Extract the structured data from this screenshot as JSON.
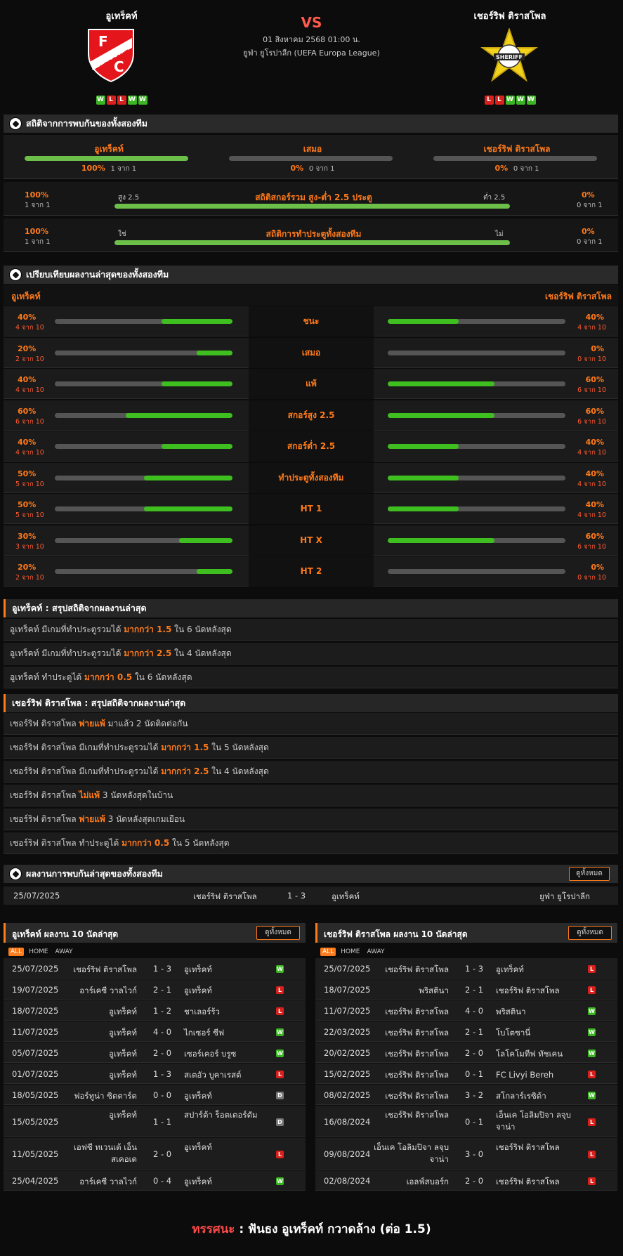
{
  "match": {
    "home": "อูเทร็คท์",
    "away": "เชอร์ริฟ ติราสโพล",
    "vs": "VS",
    "datetime": "01 สิงหาคม 2568 01:00 น.",
    "competition": "ยูฟ่า ยูโรปาลีก (UEFA Europa League)",
    "home_form": [
      "W",
      "L",
      "L",
      "W",
      "W"
    ],
    "away_form": [
      "L",
      "L",
      "W",
      "W",
      "W"
    ]
  },
  "h2h": {
    "title": "สถิติจากการพบกันของทั้งสองทีม",
    "home_label": "อูเทร็คท์",
    "draw_label": "เสมอ",
    "away_label": "เชอร์ริฟ ติราสโพล",
    "home_pct": "100%",
    "home_of": "1 จาก 1",
    "draw_pct": "0%",
    "draw_of": "0 จาก 1",
    "away_pct": "0%",
    "away_of": "0 จาก 1",
    "home_frac": 1.0,
    "draw_frac": 0,
    "away_frac": 0
  },
  "ou": {
    "title": "สถิติสกอร์รวม สูง-ต่ำ 2.5 ประตู",
    "left_label": "สูง 2.5",
    "right_label": "ต่ำ 2.5",
    "left_pct": "100%",
    "left_of": "1 จาก 1",
    "right_pct": "0%",
    "right_of": "0 จาก 1",
    "frac": 1.0
  },
  "btts": {
    "title": "สถิติการทำประตูทั้งสองทีม",
    "left_label": "ใช่",
    "right_label": "ไม่",
    "left_pct": "100%",
    "left_of": "1 จาก 1",
    "right_pct": "0%",
    "right_of": "0 จาก 1",
    "frac": 1.0
  },
  "compare": {
    "title": "เปรียบเทียบผลงานล่าสุดของทั้งสองทีม",
    "home": "อูเทร็คท์",
    "away": "เชอร์ริฟ ติราสโพล",
    "rows": [
      {
        "label": "ชนะ",
        "h_pct": "40%",
        "h_of": "4 จาก 10",
        "h": 0.4,
        "a_pct": "40%",
        "a_of": "4 จาก 10",
        "a": 0.4
      },
      {
        "label": "เสมอ",
        "h_pct": "20%",
        "h_of": "2 จาก 10",
        "h": 0.2,
        "a_pct": "0%",
        "a_of": "0 จาก 10",
        "a": 0
      },
      {
        "label": "แพ้",
        "h_pct": "40%",
        "h_of": "4 จาก 10",
        "h": 0.4,
        "a_pct": "60%",
        "a_of": "6 จาก 10",
        "a": 0.6
      },
      {
        "label": "สกอร์สูง 2.5",
        "h_pct": "60%",
        "h_of": "6 จาก 10",
        "h": 0.6,
        "a_pct": "60%",
        "a_of": "6 จาก 10",
        "a": 0.6
      },
      {
        "label": "สกอร์ต่ำ 2.5",
        "h_pct": "40%",
        "h_of": "4 จาก 10",
        "h": 0.4,
        "a_pct": "40%",
        "a_of": "4 จาก 10",
        "a": 0.4
      },
      {
        "label": "ทำประตูทั้งสองทีม",
        "h_pct": "50%",
        "h_of": "5 จาก 10",
        "h": 0.5,
        "a_pct": "40%",
        "a_of": "4 จาก 10",
        "a": 0.4
      },
      {
        "label": "HT 1",
        "h_pct": "50%",
        "h_of": "5 จาก 10",
        "h": 0.5,
        "a_pct": "40%",
        "a_of": "4 จาก 10",
        "a": 0.4
      },
      {
        "label": "HT X",
        "h_pct": "30%",
        "h_of": "3 จาก 10",
        "h": 0.3,
        "a_pct": "60%",
        "a_of": "6 จาก 10",
        "a": 0.6
      },
      {
        "label": "HT 2",
        "h_pct": "20%",
        "h_of": "2 จาก 10",
        "h": 0.2,
        "a_pct": "0%",
        "a_of": "0 จาก 10",
        "a": 0
      }
    ]
  },
  "home_summary": {
    "title": "อูเทร็คท์ : สรุปสถิติจากผลงานล่าสุด",
    "rows": [
      [
        "อูเทร็คท์  มีเกมที่ทำประตูรวมได้ ",
        "มากกว่า  1.5",
        " ใน 6 นัดหลังสุด"
      ],
      [
        "อูเทร็คท์  มีเกมที่ทำประตูรวมได้ ",
        "มากกว่า  2.5",
        " ใน 4 นัดหลังสุด"
      ],
      [
        "อูเทร็คท์  ทำประตูได้ ",
        "มากกว่า  0.5",
        " ใน 6 นัดหลังสุด"
      ]
    ]
  },
  "away_summary": {
    "title": "เชอร์ริฟ ติราสโพล : สรุปสถิติจากผลงานล่าสุด",
    "rows": [
      [
        "เชอร์ริฟ ติราสโพล ",
        "พ่ายแพ้",
        " มาแล้ว 2 นัดติดต่อกัน"
      ],
      [
        "เชอร์ริฟ ติราสโพล  มีเกมที่ทำประตูรวมได้ ",
        "มากกว่า  1.5",
        " ใน 5 นัดหลังสุด"
      ],
      [
        "เชอร์ริฟ ติราสโพล  มีเกมที่ทำประตูรวมได้ ",
        "มากกว่า  2.5",
        " ใน 4 นัดหลังสุด"
      ],
      [
        "เชอร์ริฟ ติราสโพล ",
        "ไม่แพ้",
        " 3  นัดหลังสุดในบ้าน"
      ],
      [
        "เชอร์ริฟ ติราสโพล ",
        "พ่ายแพ้",
        " 3  นัดหลังสุดเกมเยือน"
      ],
      [
        "เชอร์ริฟ ติราสโพล  ทำประตูได้ ",
        "มากกว่า  0.5",
        " ใน 5 นัดหลังสุด"
      ]
    ]
  },
  "h2h_results": {
    "title": "ผลงานการพบกันล่าสุดของทั้งสองทีม",
    "view_all": "ดูทั้งหมด",
    "rows": [
      {
        "date": "25/07/2025",
        "home": "เชอร์ริฟ ติราสโพล",
        "score": "1 - 3",
        "away": "อูเทร็คท์",
        "comp": "ยูฟ่า ยูโรปาลีก"
      }
    ]
  },
  "home_last": {
    "title": "อูเทร็คท์ ผลงาน 10 นัดล่าสุด",
    "view_all": "ดูทั้งหมด",
    "tabs": [
      "ALL",
      "HOME",
      "AWAY"
    ],
    "rows": [
      {
        "date": "25/07/2025",
        "home": "เชอร์ริฟ ติราสโพล",
        "score": "1 - 3",
        "away": "อูเทร็คท์",
        "r": "W"
      },
      {
        "date": "19/07/2025",
        "home": "อาร์เคซี วาลไวก์",
        "score": "2 - 1",
        "away": "อูเทร็คท์",
        "r": "L"
      },
      {
        "date": "18/07/2025",
        "home": "อูเทร็คท์",
        "score": "1 - 2",
        "away": "ชาเลอร์ร้ว",
        "r": "L"
      },
      {
        "date": "11/07/2025",
        "home": "อูเทร็คท์",
        "score": "4 - 0",
        "away": "ไกเซอร์ ซีฟ",
        "r": "W"
      },
      {
        "date": "05/07/2025",
        "home": "อูเทร็คท์",
        "score": "2 - 0",
        "away": "เซอร์เคอร์ บรูซ",
        "r": "W"
      },
      {
        "date": "01/07/2025",
        "home": "อูเทร็คท์",
        "score": "1 - 3",
        "away": "สเตอัว บูคาเรสต์",
        "r": "L"
      },
      {
        "date": "18/05/2025",
        "home": "ฟอร์ทูน่า ซิตตาร์ด",
        "score": "0 - 0",
        "away": "อูเทร็คท์",
        "r": "D"
      },
      {
        "date": "15/05/2025",
        "home": "อูเทร็คท์",
        "score": "1 - 1",
        "away": "สปาร์ต้า ร็อตเตอร์ดัม",
        "r": "D"
      },
      {
        "date": "11/05/2025",
        "home": "เอฟซี ทเวนเต้ เอ็นสเคอเด",
        "score": "2 - 0",
        "away": "อูเทร็คท์",
        "r": "L"
      },
      {
        "date": "25/04/2025",
        "home": "อาร์เคซี วาลไวก์",
        "score": "0 - 4",
        "away": "อูเทร็คท์",
        "r": "W"
      }
    ]
  },
  "away_last": {
    "title": "เชอร์ริฟ ติราสโพล ผลงาน 10 นัดล่าสุด",
    "view_all": "ดูทั้งหมด",
    "tabs": [
      "ALL",
      "HOME",
      "AWAY"
    ],
    "rows": [
      {
        "date": "25/07/2025",
        "home": "เชอร์ริฟ ติราสโพล",
        "score": "1 - 3",
        "away": "อูเทร็คท์",
        "r": "L"
      },
      {
        "date": "18/07/2025",
        "home": "พริสตินา",
        "score": "2 - 1",
        "away": "เชอร์ริฟ ติราสโพล",
        "r": "L"
      },
      {
        "date": "11/07/2025",
        "home": "เชอร์ริฟ ติราสโพล",
        "score": "4 - 0",
        "away": "พริสตินา",
        "r": "W"
      },
      {
        "date": "22/03/2025",
        "home": "เชอร์ริฟ ติราสโพล",
        "score": "2 - 1",
        "away": "โบโตซานี่",
        "r": "W"
      },
      {
        "date": "20/02/2025",
        "home": "เชอร์ริฟ ติราสโพล",
        "score": "2 - 0",
        "away": "โลโคโมทีฟ ทัชเคน",
        "r": "W"
      },
      {
        "date": "15/02/2025",
        "home": "เชอร์ริฟ ติราสโพล",
        "score": "0 - 1",
        "away": "FC Livyi Bereh",
        "r": "L"
      },
      {
        "date": "08/02/2025",
        "home": "เชอร์ริฟ ติราสโพล",
        "score": "3 - 2",
        "away": "สโกลาร์เรซิต้า",
        "r": "W"
      },
      {
        "date": "16/08/2024",
        "home": "เชอร์ริฟ ติราสโพล",
        "score": "0 - 1",
        "away": "เอ็นเค โอลิมปิจา ลจุบจาน่า",
        "r": "L"
      },
      {
        "date": "09/08/2024",
        "home": "เอ็นเค โอลิมปิจา ลจุบจาน่า",
        "score": "3 - 0",
        "away": "เชอร์ริฟ ติราสโพล",
        "r": "L"
      },
      {
        "date": "02/08/2024",
        "home": "เอลฟ์สบอร์ก",
        "score": "2 - 0",
        "away": "เชอร์ริฟ ติราสโพล",
        "r": "L"
      }
    ]
  },
  "verdict": {
    "label": "ทรรศนะ",
    "sep": " :  ",
    "text": "ฟันธง อูเทร็คท์ กวาดล้าง (ต่อ 1.5)"
  },
  "colors": {
    "accent": "#ff7a1a",
    "win": "#3cb524",
    "loss": "#d8201c",
    "draw": "#777777"
  }
}
